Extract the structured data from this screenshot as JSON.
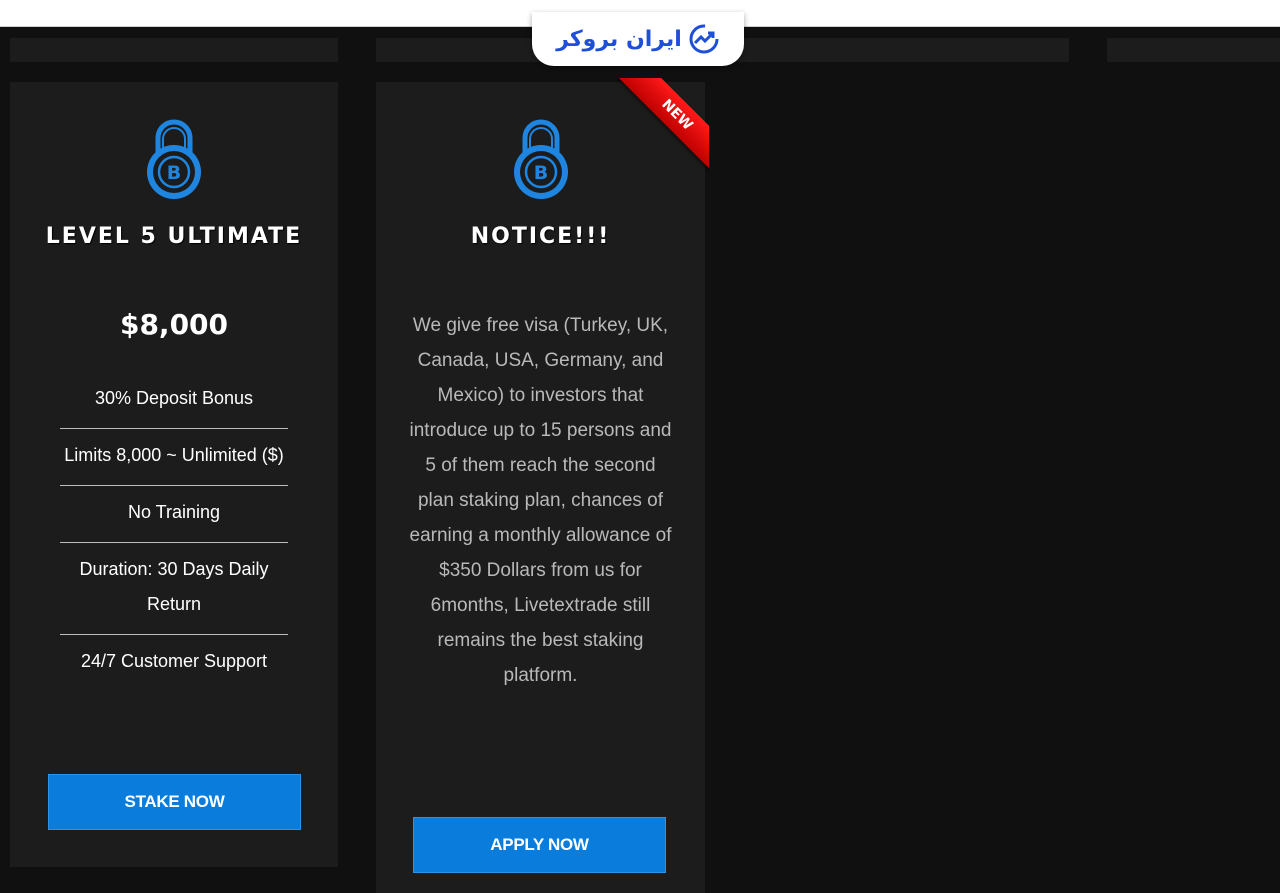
{
  "watermark": {
    "text": "ایران بروکر",
    "icon": "trend-chart-icon"
  },
  "cards": [
    {
      "icon": "bitcoin-lock-icon",
      "title": "LEVEL 5 ULTIMATE",
      "price": "$8,000",
      "features": [
        "30% Deposit Bonus",
        "Limits 8,000 ~ Unlimited ($)",
        "No Training",
        "Duration: 30 Days Daily Return",
        "24/7 Customer Support"
      ],
      "button": "STAKE NOW"
    },
    {
      "icon": "bitcoin-lock-icon",
      "ribbon": "NEW",
      "title": "NOTICE!!!",
      "body": "We give free visa (Turkey, UK, Canada, USA, Germany, and Mexico) to investors that introduce up to 15 persons and 5 of them reach the second plan staking plan, chances of earning a monthly allowance of $350 Dollars from us for 6months, Livetextrade still remains the best staking platform.",
      "button": "APPLY NOW"
    }
  ],
  "colors": {
    "background": "#101010",
    "card": "#1c1c1c",
    "accent_blue": "#0a7ddc",
    "icon_blue": "#1e86e0",
    "ribbon_red": "#e00000"
  }
}
